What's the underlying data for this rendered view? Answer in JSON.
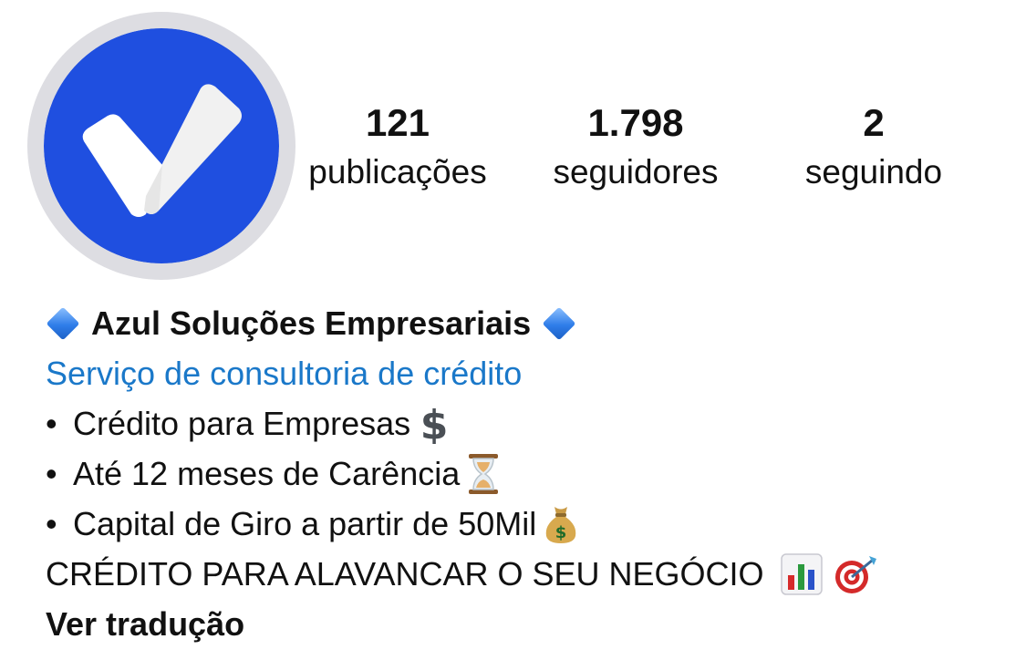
{
  "profile": {
    "avatar_icon": "blue-checkmark-icon",
    "avatar_color": "#1f4fe0",
    "stats": {
      "posts_count": "121",
      "posts_label": "publicações",
      "followers_count": "1.798",
      "followers_label": "seguidores",
      "following_count": "2",
      "following_label": "seguindo"
    },
    "bio": {
      "name": "Azul Soluções Empresariais",
      "name_icons": [
        "blue-diamond-icon",
        "blue-diamond-icon"
      ],
      "category": "Serviço de consultoria de crédito",
      "category_color": "#1a78c9",
      "bullets": [
        {
          "bullet": "•",
          "text": "Crédito para Empresas",
          "icon": "dollar-sign-icon"
        },
        {
          "bullet": "•",
          "text": "Até 12 meses de Carência",
          "icon": "hourglass-icon"
        },
        {
          "bullet": "•",
          "text": "Capital de Giro a partir de 50Mil",
          "icon": "money-bag-icon"
        }
      ],
      "headline": "CRÉDITO PARA ALAVANCAR O SEU NEGÓCIO",
      "headline_icons": [
        "bar-chart-icon",
        "target-icon"
      ],
      "translate_link": "Ver tradução"
    }
  }
}
